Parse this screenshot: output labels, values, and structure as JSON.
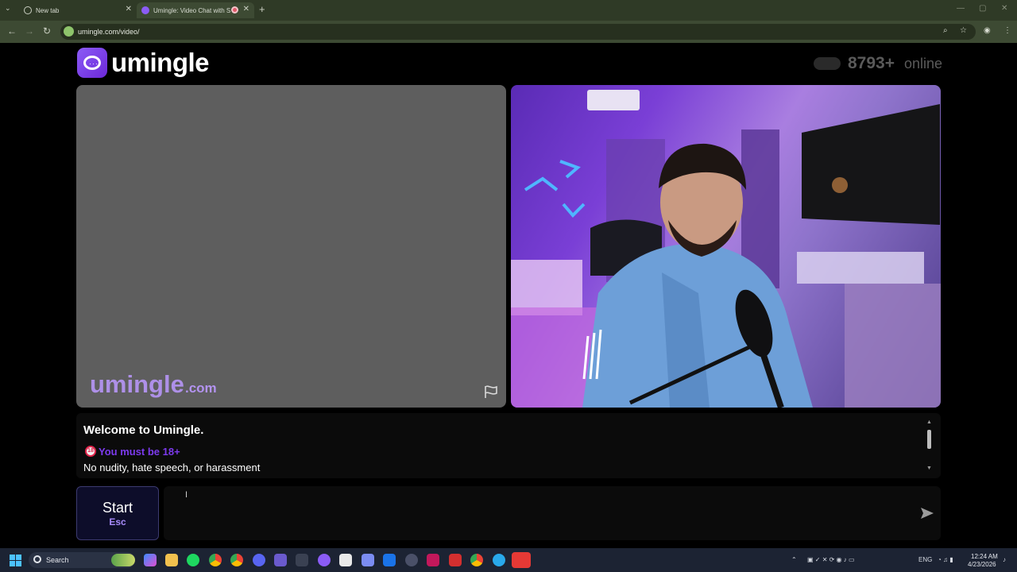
{
  "browser": {
    "tabs": [
      {
        "title": "New tab"
      },
      {
        "title": "Umingle: Video Chat with S"
      }
    ],
    "url": "umingle.com/video/"
  },
  "site": {
    "logo_text": "umingle",
    "online_count": "8793+",
    "online_label": "online",
    "watermark_name": "umingle",
    "watermark_domain": ".com",
    "brand_color": "#7c3aed"
  },
  "chat": {
    "welcome": "Welcome to Umingle.",
    "age_notice": "You must be 18+",
    "rules": "No nudity, hate speech, or harassment"
  },
  "controls": {
    "start_label": "Start",
    "start_key": "Esc",
    "message_placeholder": ""
  },
  "taskbar": {
    "search_label": "Search",
    "language": "ENG",
    "time": "12:24 AM",
    "date": "4/23/2026"
  }
}
